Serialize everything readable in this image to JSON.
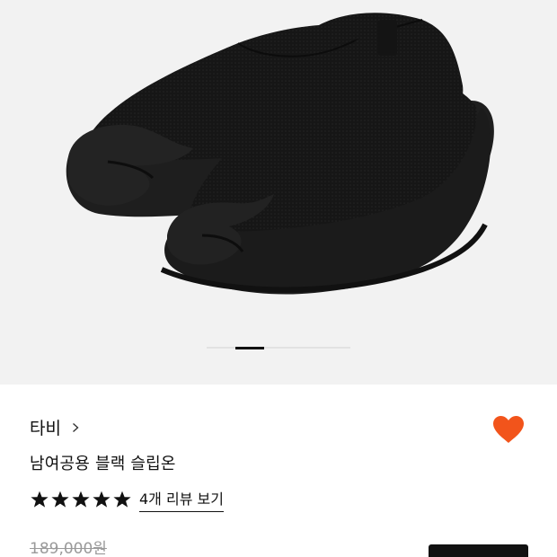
{
  "product": {
    "brand": "타비",
    "name": "남여공용 블랙 슬립온",
    "rating": 5,
    "review_link": "4개 리뷰 보기",
    "original_price": "189,000원",
    "liked": true
  },
  "gallery": {
    "slide_count": 5,
    "active_slide": 2
  },
  "colors": {
    "heart": "#f2541b",
    "stars": "#111111",
    "old_price": "#9a9a9a",
    "background": "#f2f2f2"
  },
  "icons": {
    "brand_chevron": "chevron-right-icon",
    "like": "heart-icon",
    "rating": "star-icon"
  }
}
